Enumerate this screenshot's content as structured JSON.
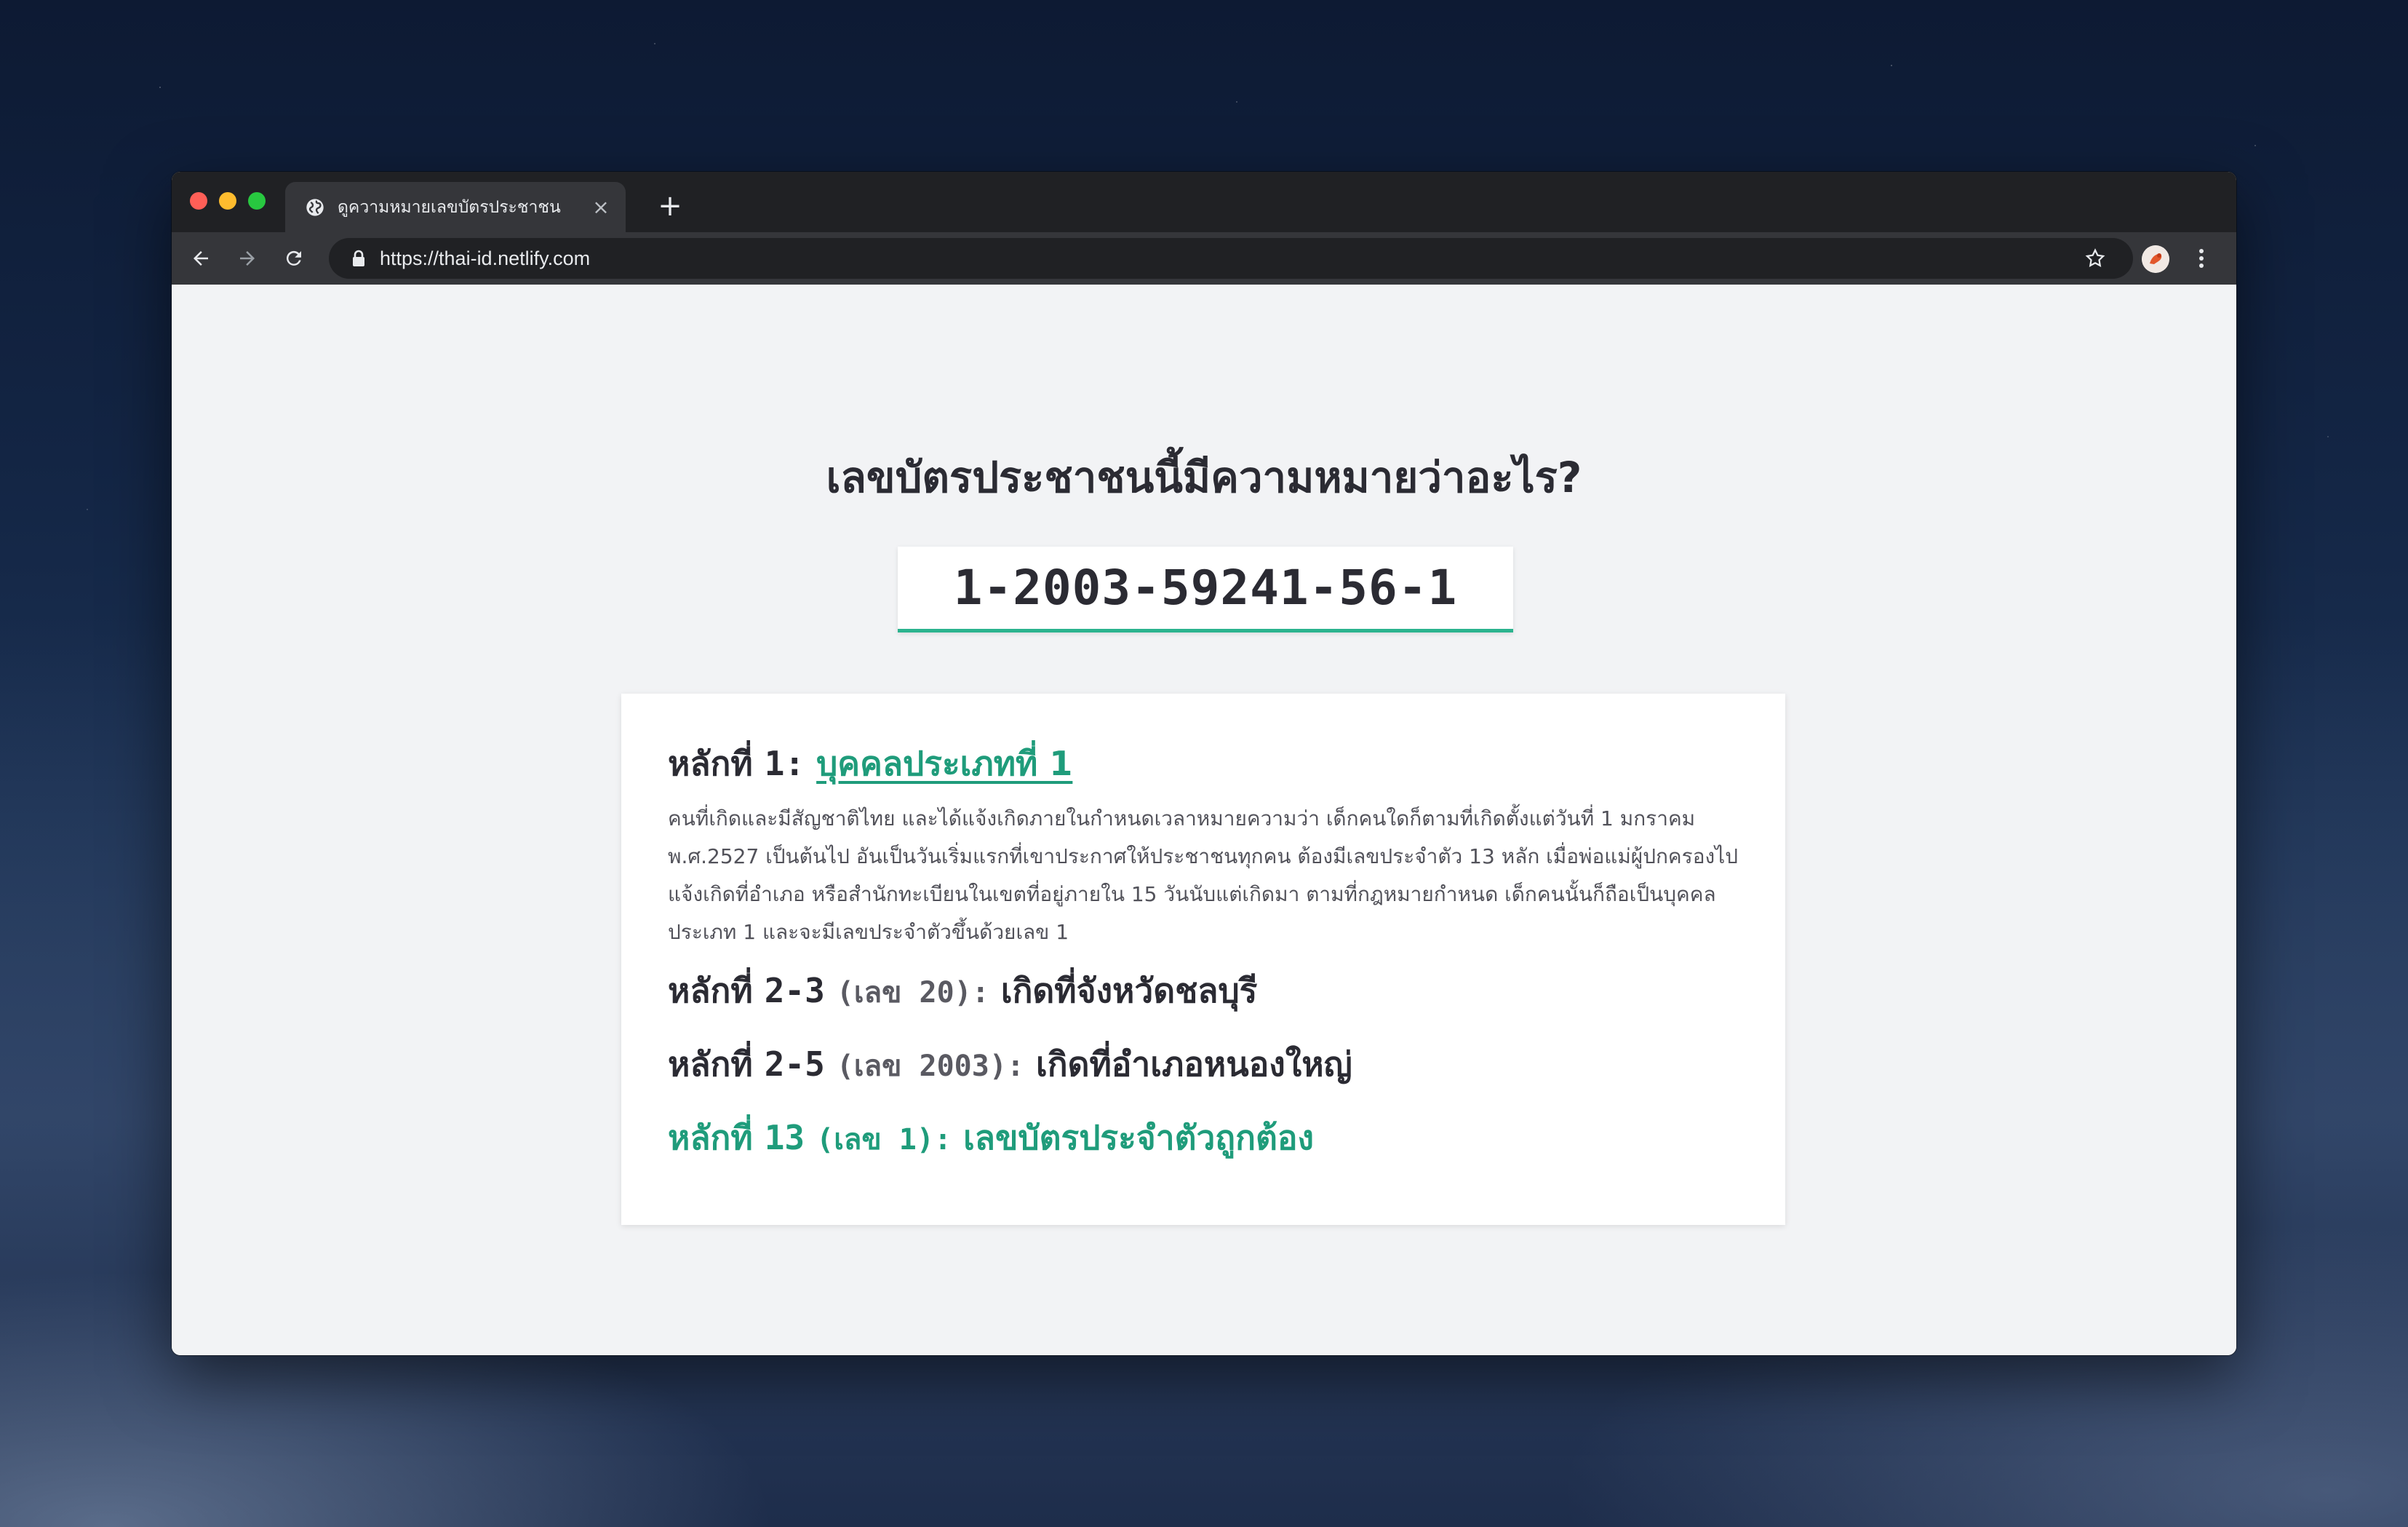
{
  "browser": {
    "tab_title": "ดูความหมายเลขบัตรประชาชน",
    "url": "https://thai-id.netlify.com",
    "new_tab_label": "+",
    "close_tab_label": "×"
  },
  "page": {
    "heading": "เลขบัตรประชาชนนี้มีความหมายว่าอะไร?",
    "id_number": "1-2003-59241-56-1"
  },
  "breakdown": {
    "digit1": {
      "prefix": "หลักที่",
      "position": "1:",
      "meaning": "บุคคลประเภทที่ 1",
      "description": "คนที่เกิดและมีสัญชาติไทย และได้แจ้งเกิดภายในกำหนดเวลาหมายความว่า เด็กคนใดก็ตามที่เกิดตั้งแต่วันที่ 1 มกราคม พ.ศ.2527 เป็นต้นไป อันเป็นวันเริ่มแรกที่เขาประกาศให้ประชาชนทุกคน ต้องมีเลขประจำตัว 13 หลัก เมื่อพ่อแม่ผู้ปกครองไปแจ้งเกิดที่อำเภอ หรือสำนักทะเบียนในเขตที่อยู่ภายใน 15 วันนับแต่เกิดมา ตามที่กฎหมายกำหนด เด็กคนนั้นก็ถือเป็นบุคคลประเภท 1 และจะมีเลขประจำตัวขึ้นด้วยเลข 1"
    },
    "digit2_3": {
      "prefix": "หลักที่",
      "position": "2-3",
      "number_label": "(เลข 20):",
      "meaning": "เกิดที่จังหวัดชลบุรี"
    },
    "digit2_5": {
      "prefix": "หลักที่",
      "position": "2-5",
      "number_label": "(เลข 2003):",
      "meaning": "เกิดที่อำเภอหนองใหญ่"
    },
    "digit13": {
      "prefix": "หลักที่",
      "position": "13",
      "number_label": "(เลข 1):",
      "meaning": "เลขบัตรประจำตัวถูกต้อง"
    }
  },
  "colors": {
    "accent": "#1f9c7b",
    "input_underline": "#2bb38e",
    "text": "#2b2b33",
    "page_bg": "#f2f3f5"
  }
}
